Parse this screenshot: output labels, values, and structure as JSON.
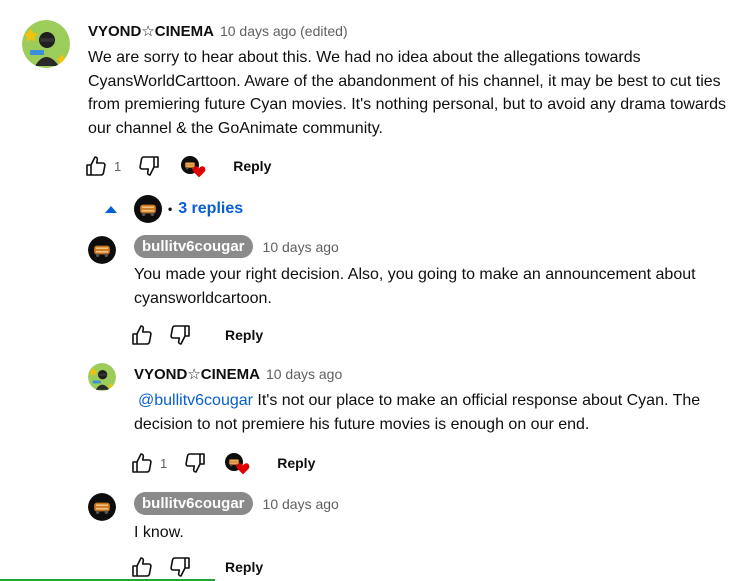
{
  "comments": [
    {
      "author": "VYOND☆CINEMA",
      "meta": "10 days ago (edited)",
      "text": "We are sorry to hear about this. We had no idea about the allegations towards CyansWorldCarttoon. Aware of the abandonment of his channel, it may be best to cut ties from premiering future Cyan movies. It's nothing personal, but to avoid any drama towards our channel & the GoAnimate community.",
      "likes": "1",
      "reply_label": "Reply"
    },
    {
      "author": "bullitv6cougar",
      "meta": "10 days ago",
      "text": "You made your right decision. Also, you going to make an announcement about cyansworldcartoon.",
      "reply_label": "Reply"
    },
    {
      "author": "VYOND☆CINEMA",
      "meta": "10 days ago",
      "mention": "@bullitv6cougar",
      "text": " It's not our place to make an official response about Cyan. The decision to not premiere his future movies is enough on our end.",
      "likes": "1",
      "reply_label": "Reply"
    },
    {
      "author": "bullitv6cougar",
      "meta": "10 days ago",
      "text": "I know.",
      "reply_label": "Reply"
    }
  ],
  "replies_toggle": {
    "separator": "•",
    "label": "3 replies"
  },
  "colors": {
    "link_blue": "#065fd4",
    "heart_red": "#e00000",
    "chip_gray": "#8a8a8a"
  },
  "icons": [
    "thumbs-up-icon",
    "thumbs-down-icon",
    "creator-heart-icon",
    "collapse-arrow-icon"
  ]
}
